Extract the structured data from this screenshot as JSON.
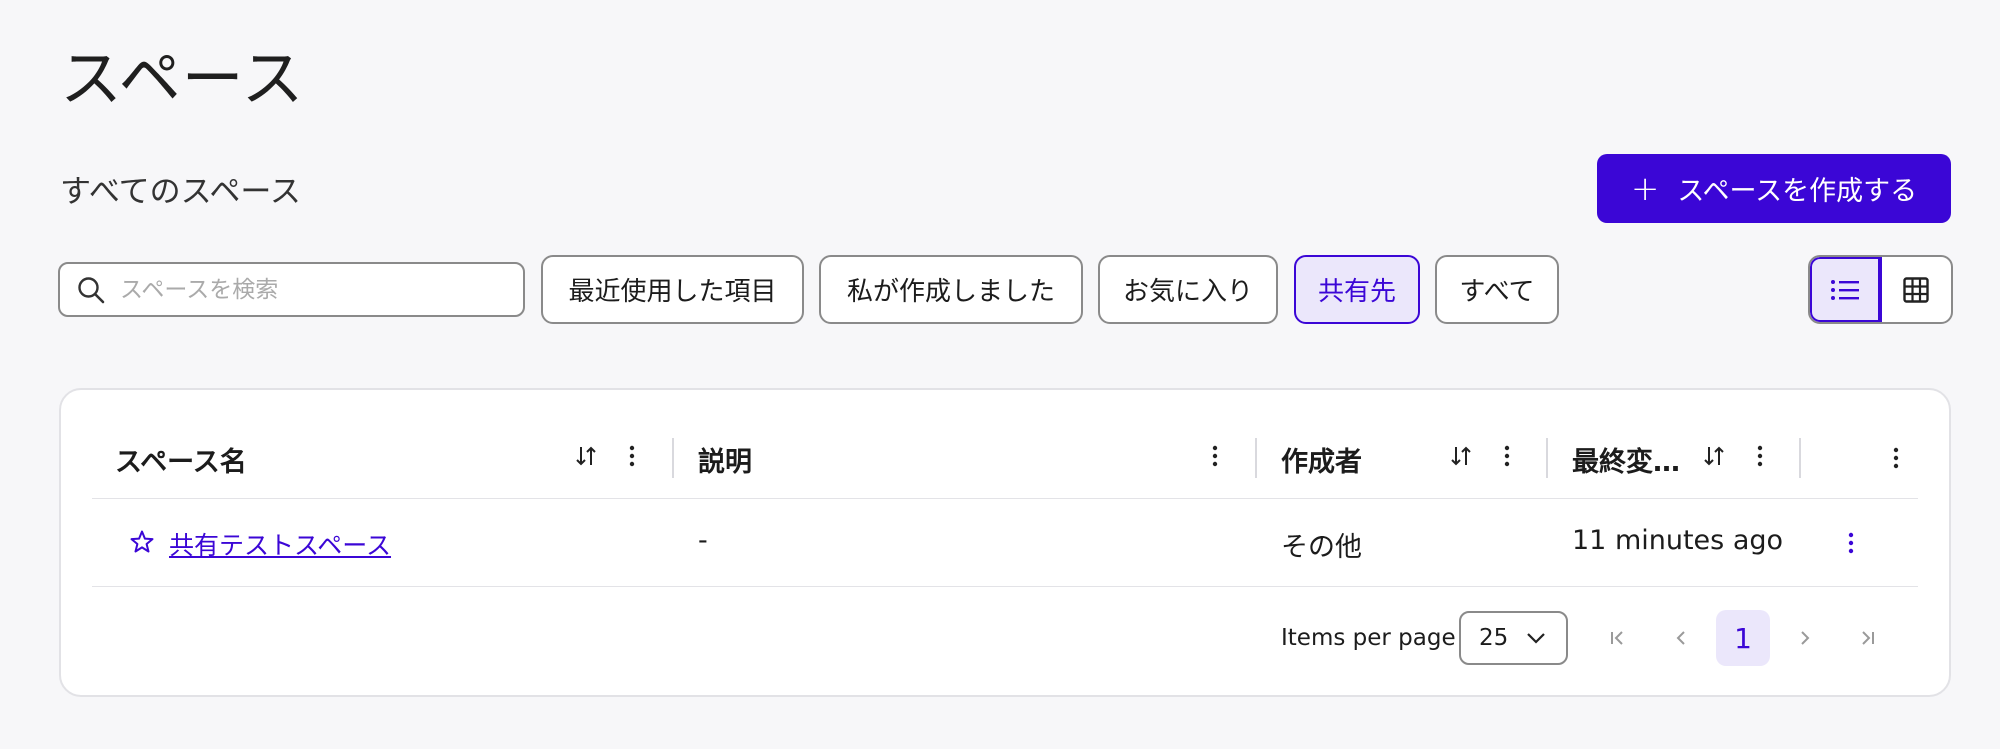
{
  "page": {
    "title": "スペース",
    "subtitle": "すべてのスペース"
  },
  "create_button": {
    "label": "スペースを作成する",
    "icon": "plus-icon"
  },
  "search": {
    "placeholder": "スペースを検索",
    "value": "",
    "icon": "search-icon"
  },
  "filters": [
    {
      "label": "最近使用した項目",
      "active": false
    },
    {
      "label": "私が作成しました",
      "active": false
    },
    {
      "label": "お気に入り",
      "active": false
    },
    {
      "label": "共有先",
      "active": true
    },
    {
      "label": "すべて",
      "active": false
    }
  ],
  "view_toggle": {
    "selected": "list",
    "options": [
      "list-view-icon",
      "grid-view-icon"
    ]
  },
  "table": {
    "columns": [
      {
        "label": "スペース名",
        "sortable": true
      },
      {
        "label": "説明",
        "sortable": false
      },
      {
        "label": "作成者",
        "sortable": true
      },
      {
        "label": "最終変…",
        "sortable": true
      },
      {
        "label": "",
        "sortable": false
      }
    ],
    "rows": [
      {
        "favorite": false,
        "name": "共有テストスペース",
        "description": "-",
        "creator": "その他",
        "modified": "11 minutes ago"
      }
    ]
  },
  "pagination": {
    "items_per_page_label": "Items per page",
    "items_per_page": "25",
    "current_page": "1"
  },
  "colors": {
    "accent": "#3b06d6",
    "accent_light": "#ebe7fb",
    "background": "#f7f7f9"
  }
}
